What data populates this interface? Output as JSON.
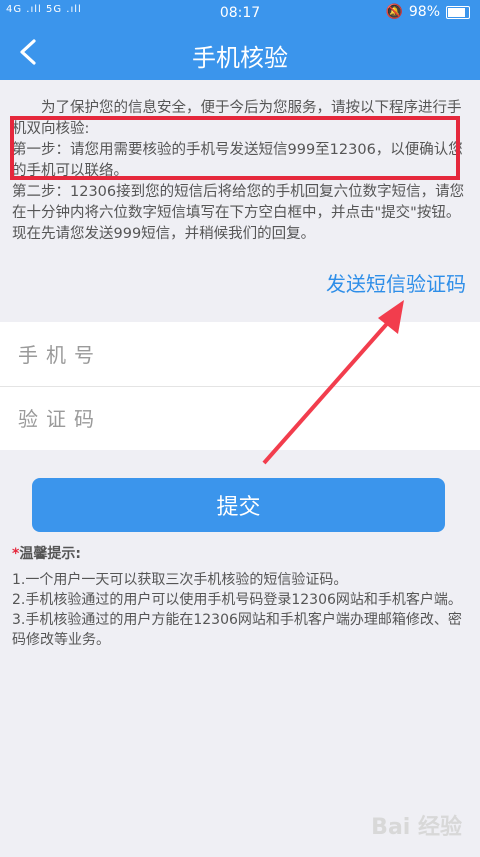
{
  "statusbar": {
    "signal": "4G .ıll 5G .ıll",
    "time": "08:17",
    "battery": "98%"
  },
  "header": {
    "title": "手机核验"
  },
  "intro": {
    "p1": "为了保护您的信息安全，便于今后为您服务，请按以下程序进行手机双向核验:",
    "p2": "第一步：请您用需要核验的手机号发送短信999至12306，以便确认您的手机可以联络。",
    "p3": "第二步：12306接到您的短信后将给您的手机回复六位数字短信，请您在十分钟内将六位数字短信填写在下方空白框中，并点击\"提交\"按钮。现在先请您发送999短信，并稍候我们的回复。"
  },
  "send_link": "发送短信验证码",
  "form": {
    "phone_placeholder": "手机号",
    "code_placeholder": "验证码",
    "submit_label": "提交"
  },
  "tips": {
    "star": "*",
    "title": "温馨提示:",
    "items": [
      "1.一个用户一天可以获取三次手机核验的短信验证码。",
      "2.手机核验通过的用户可以使用手机号码登录12306网站和手机客户端。",
      "3.手机核验通过的用户方能在12306网站和手机客户端办理邮箱修改、密码修改等业务。"
    ]
  },
  "watermark": "Bai 经验",
  "colors": {
    "primary": "#3b95ec",
    "highlight": "#e5283c",
    "link": "#2e8ee8"
  }
}
